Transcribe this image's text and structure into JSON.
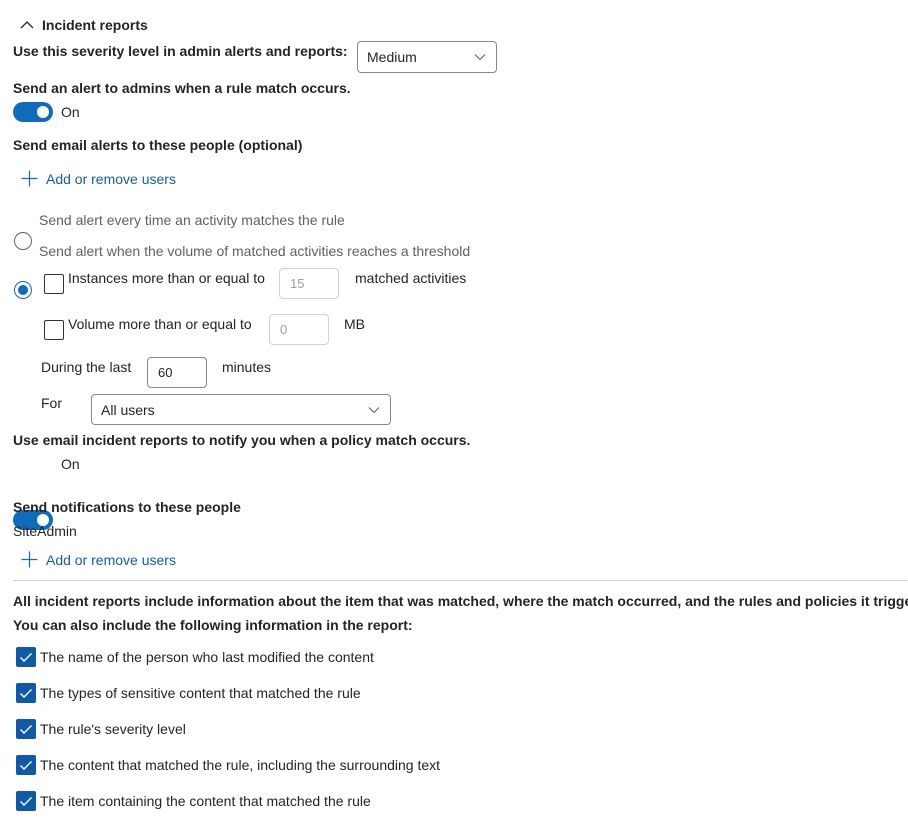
{
  "section": {
    "title": "Incident reports"
  },
  "severity": {
    "label": "Use this severity level in admin alerts and reports:",
    "value": "Medium"
  },
  "admin_alert": {
    "label": "Send an alert to admins when a rule match occurs.",
    "toggle_state": "On"
  },
  "email_alerts": {
    "label": "Send email alerts to these people (optional)",
    "add_label": "Add or remove users"
  },
  "alert_frequency": {
    "option_every": "Send alert every time an activity matches the rule",
    "option_threshold": "Send alert when the volume of matched activities reaches a threshold",
    "selected": "threshold"
  },
  "threshold": {
    "instances_label": "Instances more than or equal to",
    "instances_value": "15",
    "instances_suffix": "matched activities",
    "volume_label": "Volume more than or equal to",
    "volume_value": "0",
    "volume_suffix": "MB",
    "during_label": "During the last",
    "during_value": "60",
    "during_suffix": "minutes",
    "for_label": "For",
    "for_value": "All users"
  },
  "incident_reports": {
    "label": "Use email incident reports to notify you when a policy match occurs.",
    "toggle_state": "On"
  },
  "notifications": {
    "label": "Send notifications to these people",
    "user": "SiteAdmin",
    "add_label": "Add or remove users"
  },
  "report_info": {
    "line1": "All incident reports include information about the item that was matched, where the match occurred, and the rules and policies it triggered.",
    "line2": "You can also include the following information in the report:",
    "options": [
      "The name of the person who last modified the content",
      "The types of sensitive content that matched the rule",
      "The rule's severity level",
      "The content that matched the rule, including the surrounding text",
      "The item containing the content that matched the rule"
    ]
  },
  "colors": {
    "accent": "#0f6cbd",
    "checkbox": "#0f5aa6",
    "link": "#115ea3"
  }
}
